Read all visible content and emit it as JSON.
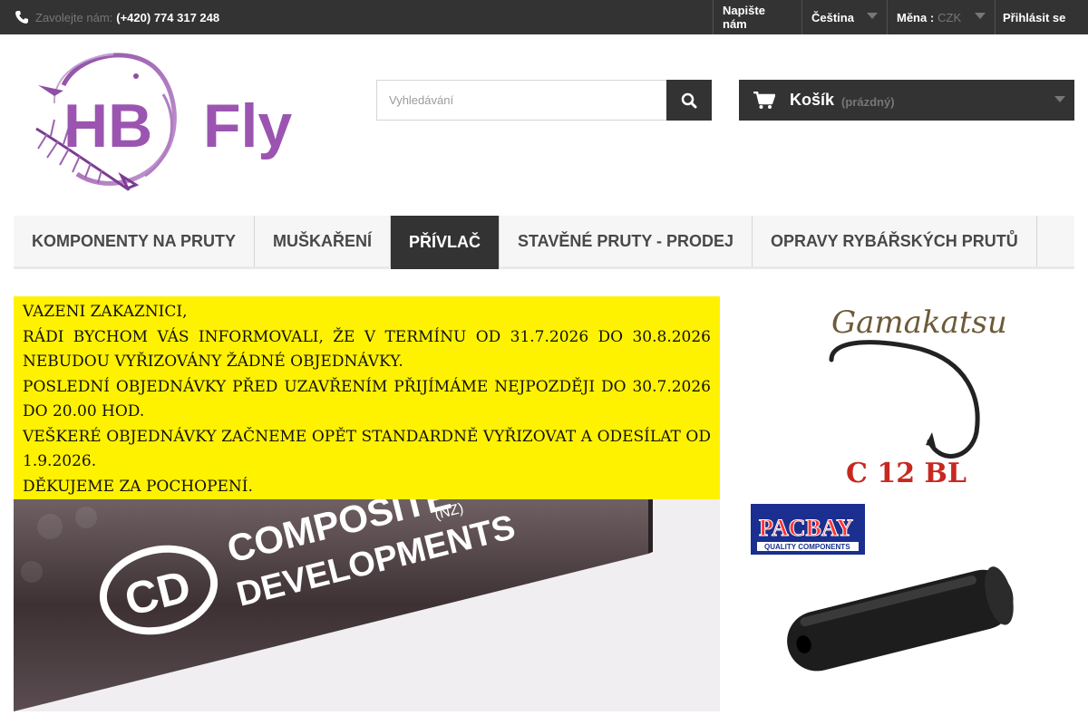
{
  "topbar": {
    "contact_label": "Zavolejte nám:",
    "phone": "(+420) 774 317 248",
    "links": [
      {
        "label": "Napište nám"
      },
      {
        "label": "Čeština"
      },
      {
        "label": "Měna :",
        "value": "CZK"
      },
      {
        "label": "Přihlásit se"
      }
    ]
  },
  "logo": {
    "text": "HB Fly"
  },
  "search": {
    "placeholder": "Vyhledávání"
  },
  "cart": {
    "label": "Košík",
    "status": "(prázdný)"
  },
  "menu": {
    "items": [
      {
        "label": "Komponenty na pruty"
      },
      {
        "label": "Muškaření"
      },
      {
        "label": "Přívlač"
      },
      {
        "label": "Stavěné pruty - prodej"
      },
      {
        "label": "Opravy rybářských prutů"
      }
    ]
  },
  "notice": {
    "lines": [
      "VAZENI ZAKAZNICI,",
      "RÁDI BYCHOM VÁS INFORMOVALI, ŽE V TERMÍNU OD 31.7.2026 DO 30.8.2026 NEBUDOU VYŘIZOVÁNY ŽÁDNÉ OBJEDNÁVKY.",
      "POSLEDNÍ OBJEDNÁVKY PŘED UZAVŘENÍM PŘIJÍMÁME NEJPOZDĚJI DO 30.7.2026 DO 20.00 HOD.",
      "VEŠKERÉ OBJEDNÁVKY ZAČNEME OPĚT STANDARDNĚ VYŘIZOVAT A ODESÍLAT OD 1.9.2026.",
      "DĚKUJEME ZA POCHOPENÍ."
    ]
  },
  "banner_rod": {
    "brand": "COMPOSITE",
    "brand2": "DEVELOPMENTS",
    "badge": "CD",
    "tag": "(NZ)"
  },
  "banner_hook": {
    "brand": "Gamakatsu",
    "model": "C 12 BL"
  },
  "banner_grip": {
    "brand": "PACBAY",
    "tagline": "QUALITY COMPONENTS"
  }
}
